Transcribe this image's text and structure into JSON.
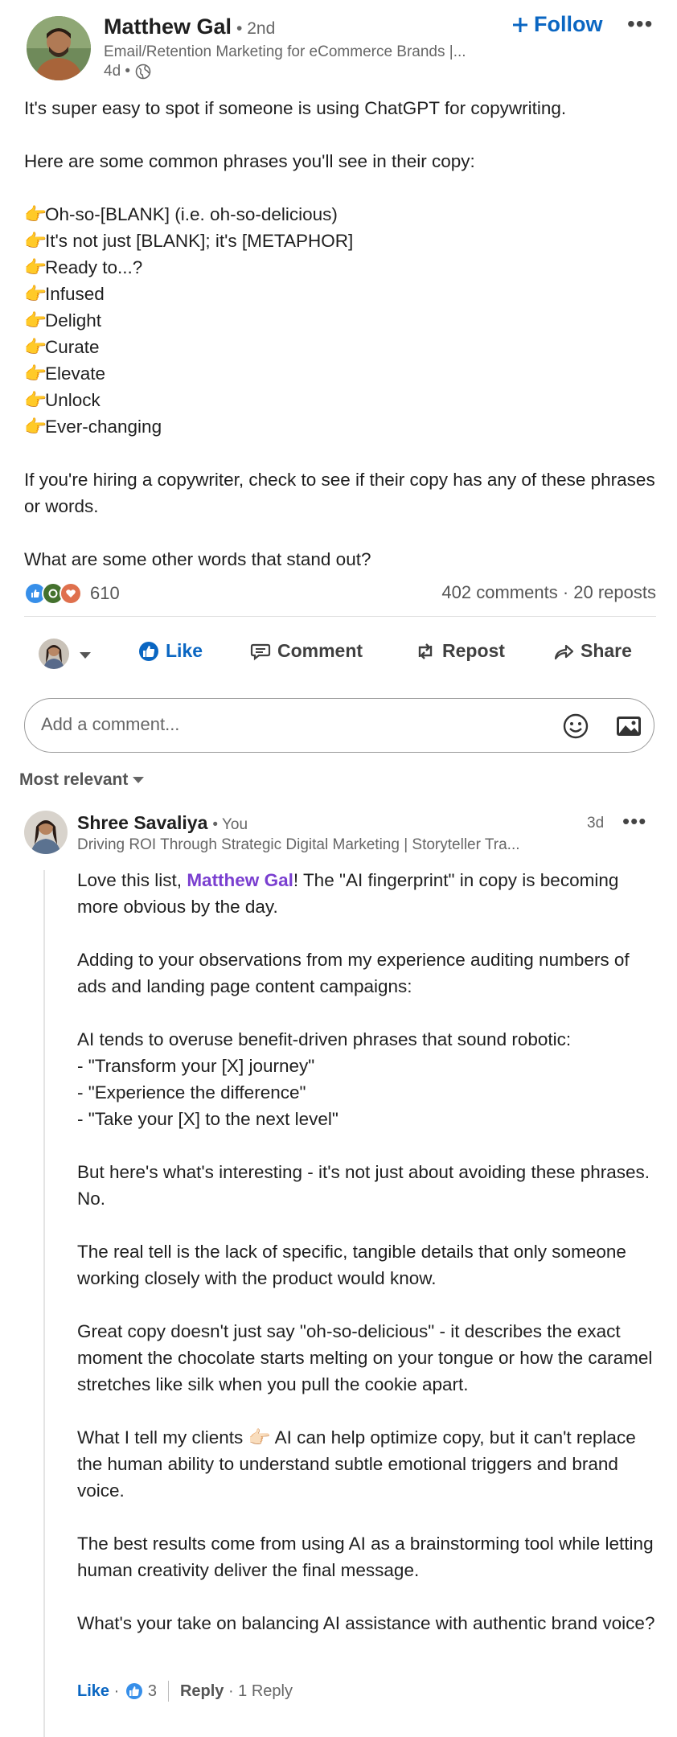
{
  "post": {
    "author_name": "Matthew Gal",
    "connection_degree": "• 2nd",
    "headline": "Email/Retention Marketing for eCommerce Brands |...",
    "time": "4d •",
    "follow_label": "Follow",
    "more_label": "•••",
    "intro": "It's super easy to spot if someone is using ChatGPT for copywriting.",
    "lead": "Here are some common phrases you'll see in their copy:",
    "bullet_emoji": "👉",
    "bullets": [
      "Oh-so-[BLANK] (i.e. oh-so-delicious)",
      "It's not just [BLANK]; it's [METAPHOR]",
      "Ready to...?",
      "Infused",
      "Delight",
      "Curate",
      "Elevate",
      "Unlock",
      "Ever-changing"
    ],
    "closing_1": "If you're hiring a copywriter, check to see if their copy has any of these phrases or words.",
    "closing_2": "What are some other words that stand out?"
  },
  "stats": {
    "reaction_count": "610",
    "comments_reposts": "402 comments · 20 reposts",
    "reaction_colors": {
      "like": "#378fe9",
      "celebrate": "#44712e",
      "love": "#df704d"
    }
  },
  "actions": {
    "like": "Like",
    "comment": "Comment",
    "repost": "Repost",
    "share": "Share"
  },
  "comment_box": {
    "placeholder": "Add a comment..."
  },
  "sort": {
    "label": "Most relevant"
  },
  "comment": {
    "author_name": "Shree Savaliya",
    "you_label": "• You",
    "headline": "Driving ROI Through Strategic Digital Marketing | Storyteller Tra...",
    "time": "3d",
    "more_label": "•••",
    "p1_before": "Love this list, ",
    "p1_mention": "Matthew Gal",
    "p1_after": "! The \"AI fingerprint\" in copy is becoming more obvious by the day.",
    "p2": "Adding to your observations from my experience auditing numbers of ads and landing page content campaigns:",
    "p3_lead": "AI tends to overuse benefit-driven phrases that sound robotic:",
    "p3_items": [
      "- \"Transform your [X] journey\"",
      "- \"Experience the difference\"",
      "- \"Take your [X] to the next level\""
    ],
    "p4": "But here's what's interesting - it's not just about avoiding these phrases. No.",
    "p5": "The real tell is the lack of specific, tangible details that only someone working closely with the product would know.",
    "p6": "Great copy doesn't just say \"oh-so-delicious\" - it describes the exact moment the chocolate starts melting on your tongue or how the caramel stretches like silk when you pull the cookie apart.",
    "p7_before": "What I tell my clients ",
    "p7_emoji": "👉🏻",
    "p7_after": " AI can help optimize copy, but it can't replace the human ability to understand subtle emotional triggers and brand voice.",
    "p8": "The best results come from using AI as a brainstorming tool while letting human creativity deliver the final message.",
    "p9": "What's your take on balancing AI assistance with authentic brand voice?",
    "like_label": "Like",
    "dot": " · ",
    "like_count": "3",
    "reply_label": "Reply",
    "reply_count": " · 1 Reply"
  }
}
